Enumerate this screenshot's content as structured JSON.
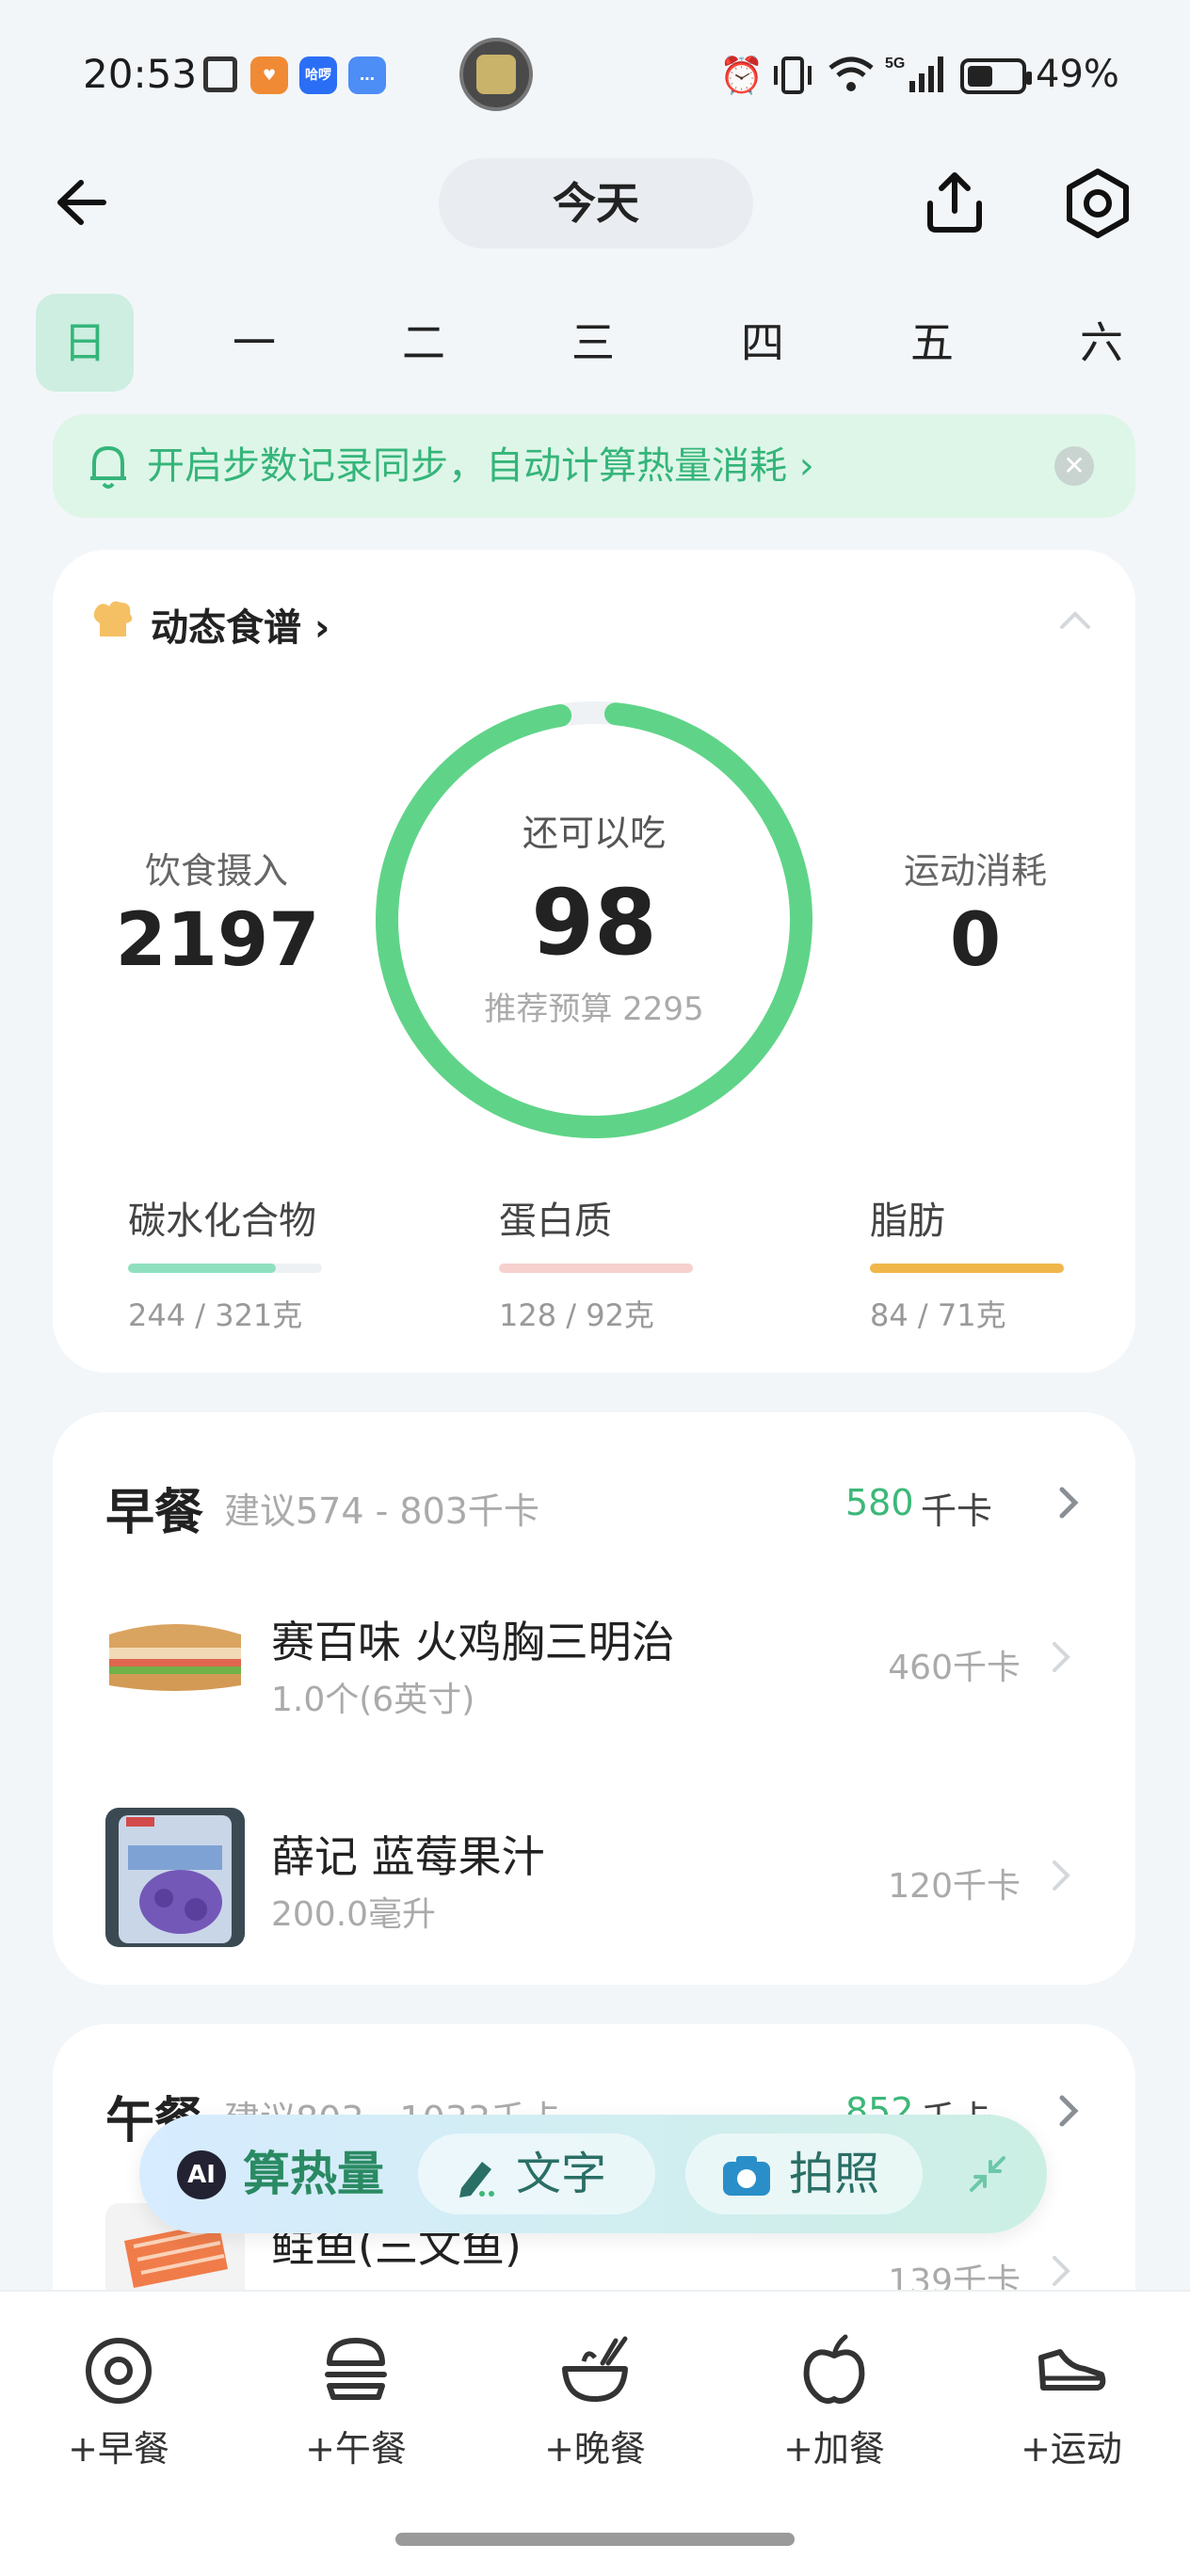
{
  "status_bar": {
    "time": "20:53",
    "app_icons": [
      {
        "name": "nfc-icon"
      },
      {
        "name": "favorite-app-icon",
        "color": "#f08a34"
      },
      {
        "name": "hellobike-app-icon",
        "color": "#2b6ef6",
        "text": "哈啰"
      },
      {
        "name": "message-app-icon",
        "color": "#4c8df6"
      }
    ],
    "battery_percent": "49%"
  },
  "header": {
    "title": "今天"
  },
  "weekdays": [
    "日",
    "一",
    "二",
    "三",
    "四",
    "五",
    "六"
  ],
  "active_weekday_index": 0,
  "banner": {
    "text": "开启步数记录同步，自动计算热量消耗 ›"
  },
  "summary": {
    "recipe_label": "动态食谱",
    "intake_label": "饮食摄入",
    "intake_value": "2197",
    "remaining_label": "还可以吃",
    "remaining_value": "98",
    "budget_text": "推荐预算 2295",
    "burn_label": "运动消耗",
    "burn_value": "0",
    "ring_progress": 0.957,
    "colors": {
      "ring": "#5fd488",
      "ring_track": "#eef2f4"
    },
    "macros": [
      {
        "name": "碳水化合物",
        "value": "244 / 321克",
        "progress": 0.76,
        "color": "#8fe0bf"
      },
      {
        "name": "蛋白质",
        "value": "128 / 92克",
        "progress": 1.0,
        "color": "#f6d1cd"
      },
      {
        "name": "脂肪",
        "value": "84 / 71克",
        "progress": 1.0,
        "color": "#f0b64a"
      }
    ]
  },
  "breakfast": {
    "title": "早餐",
    "suggest": "建议574 - 803千卡",
    "cal": "580",
    "unit": "千卡",
    "items": [
      {
        "name": "赛百味 火鸡胸三明治",
        "qty": "1.0个(6英寸)",
        "cal": "460千卡",
        "image": "sandwich-image"
      },
      {
        "name": "薛记 蓝莓果汁",
        "qty": "200.0毫升",
        "cal": "120千卡",
        "image": "juice-image"
      }
    ]
  },
  "lunch": {
    "title": "午餐",
    "suggest": "建议803 - 1033千卡",
    "cal": "852",
    "unit": "千卡",
    "items": [
      {
        "name": "鲑鱼(三文鱼)",
        "qty": "",
        "cal": "139千卡",
        "image": "salmon-image"
      }
    ]
  },
  "ai_bar": {
    "badge": "AI",
    "label": "算热量",
    "text_button": "文字",
    "photo_button": "拍照"
  },
  "bottom_nav": [
    {
      "label": "+早餐",
      "icon": "egg-icon"
    },
    {
      "label": "+午餐",
      "icon": "burger-icon"
    },
    {
      "label": "+晚餐",
      "icon": "bowl-icon"
    },
    {
      "label": "+加餐",
      "icon": "apple-icon"
    },
    {
      "label": "+运动",
      "icon": "sneaker-icon"
    }
  ]
}
